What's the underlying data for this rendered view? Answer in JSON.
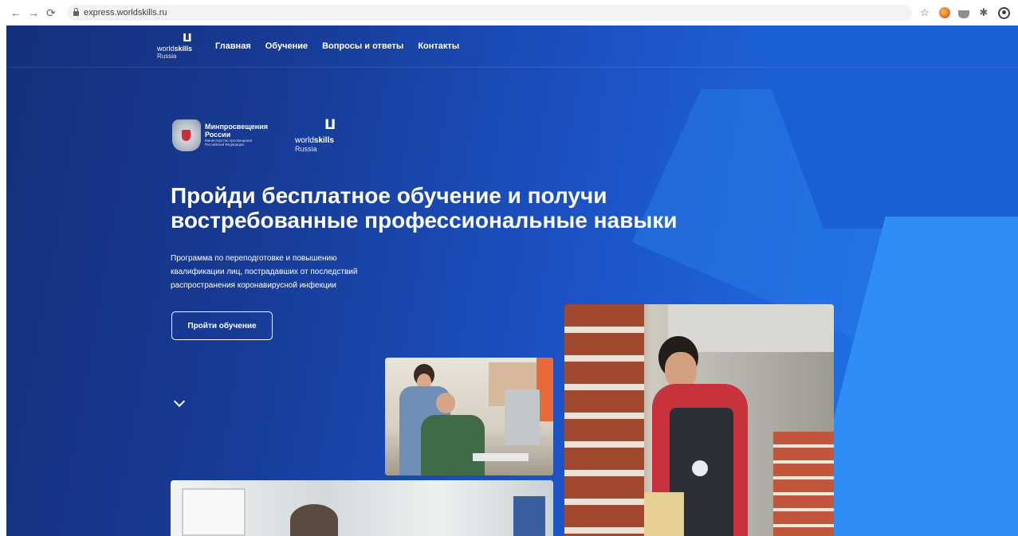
{
  "browser": {
    "url": "express.worldskills.ru",
    "icons": [
      "back-icon",
      "forward-icon",
      "reload-icon",
      "lock-icon",
      "star-icon",
      "extension-icon",
      "extension-icon",
      "puzzle-icon",
      "profile-icon"
    ]
  },
  "header": {
    "logo": {
      "line1_regular": "world",
      "line1_bold": "skills",
      "line2": "Russia"
    },
    "nav": [
      {
        "label": "Главная"
      },
      {
        "label": "Обучение"
      },
      {
        "label": "Вопросы и ответы"
      },
      {
        "label": "Контакты"
      }
    ]
  },
  "partners": {
    "ministry": {
      "name_line1": "Минпросвещения",
      "name_line2": "России",
      "small_line1": "Министерство просвещения",
      "small_line2": "Российской Федерации"
    },
    "worldskills": {
      "line1_regular": "world",
      "line1_bold": "skills",
      "line2": "Russia"
    }
  },
  "hero": {
    "title_line1": "Пройди бесплатное обучение и получи",
    "title_line2": "востребованные профессиональные навыки",
    "subtitle_line1": "Программа по переподготовке и повышению",
    "subtitle_line2": "квалификации лиц, пострадавших от последствий",
    "subtitle_line3": "распространения коронавирусной инфекции",
    "cta_label": "Пройти обучение"
  },
  "colors": {
    "bg_dark": "#14307a",
    "bg_light": "#2a8af2",
    "text": "#ffffff"
  }
}
